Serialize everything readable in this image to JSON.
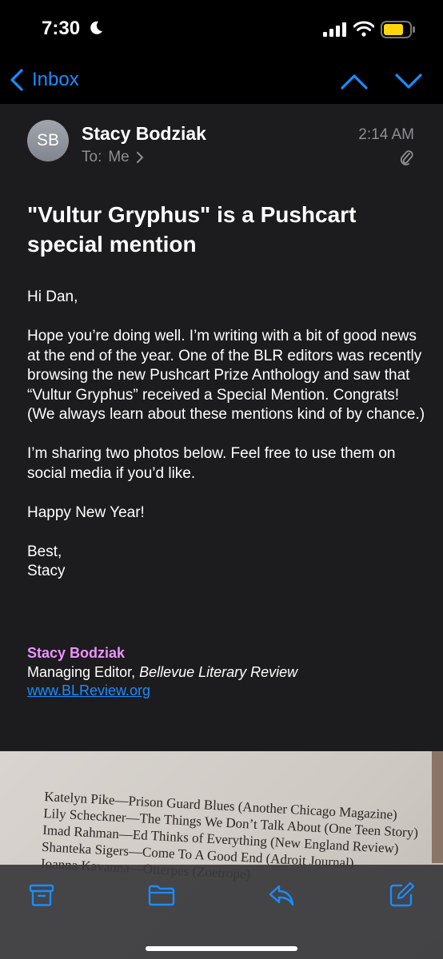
{
  "status": {
    "time": "7:30"
  },
  "nav": {
    "back_label": "Inbox"
  },
  "email": {
    "avatar_initials": "SB",
    "sender": "Stacy Bodziak",
    "to_label": "To:",
    "recipient": "Me",
    "time": "2:14 AM",
    "subject": "\"Vultur Gryphus\" is a Pushcart special mention",
    "body": {
      "greeting": "Hi Dan,",
      "p1": "Hope you’re doing well.  I’m writing with a bit of good news at the end of the year.  One of the BLR editors was recently browsing the new Pushcart Prize Anthology and saw that “Vultur Gryphus” received a Special Mention. Congrats!  (We always learn about these mentions kind of by chance.)",
      "p2": "I’m sharing two photos below. Feel free to use them on social media if you’d like.",
      "p3": "Happy New Year!",
      "closing": "Best,",
      "closing_name": "Stacy"
    },
    "signature": {
      "name": "Stacy Bodziak",
      "title_prefix": "Managing Editor, ",
      "publication": "Bellevue Literary Review",
      "link": "www.BLReview.org"
    }
  },
  "photo": {
    "lines": [
      "Katelyn Pike—Prison Guard Blues (Another Chicago Magazine)",
      "Lily Scheckner—The Things We Don’t Talk About (One Teen Story)",
      "Imad Rahman—Ed Thinks of Everything (New England Review)",
      "Shanteka Sigers—Come To A Good End (Adroit Journal)",
      "Ioanna Kavanna—Otterpes (Zoetrope)"
    ]
  },
  "toolbar": {
    "icons": [
      "archive-icon",
      "folder-icon",
      "reply-icon",
      "compose-icon"
    ]
  },
  "colors": {
    "accent": "#1a8cff",
    "card_bg": "#1c1c1e",
    "signature_name": "#ee92ff",
    "secondary_text": "#8e8e93"
  }
}
